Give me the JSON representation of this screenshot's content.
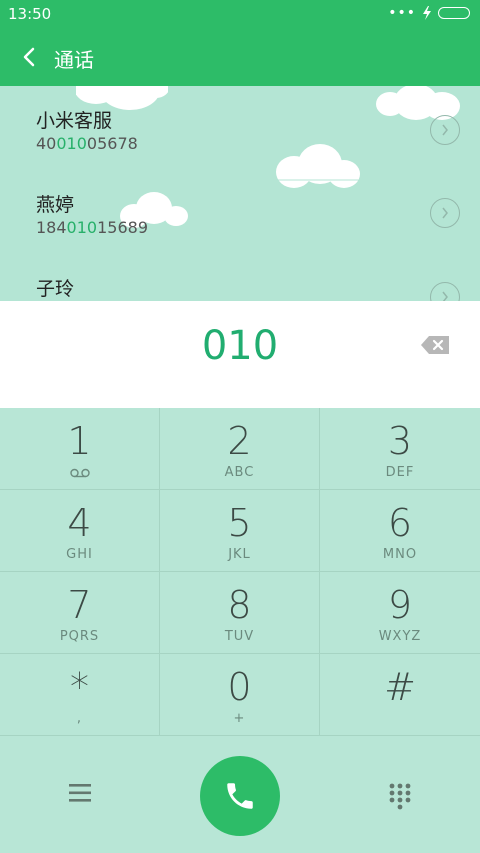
{
  "status_bar": {
    "time": "13:50"
  },
  "app_bar": {
    "title": "通话"
  },
  "results": [
    {
      "name": "小米客服",
      "number_pre": "40",
      "number_match": "010",
      "number_post": "05678"
    },
    {
      "name": "燕婷",
      "number_pre": "184",
      "number_match": "010",
      "number_post": "15689"
    },
    {
      "name": "子玲"
    }
  ],
  "input": {
    "digits": "010"
  },
  "keypad": {
    "keys": [
      {
        "digit": "1",
        "letters": ""
      },
      {
        "digit": "2",
        "letters": "ABC"
      },
      {
        "digit": "3",
        "letters": "DEF"
      },
      {
        "digit": "4",
        "letters": "GHI"
      },
      {
        "digit": "5",
        "letters": "JKL"
      },
      {
        "digit": "6",
        "letters": "MNO"
      },
      {
        "digit": "7",
        "letters": "PQRS"
      },
      {
        "digit": "8",
        "letters": "TUV"
      },
      {
        "digit": "9",
        "letters": "WXYZ"
      },
      {
        "digit": "*",
        "letters": ","
      },
      {
        "digit": "0",
        "letters": "+"
      },
      {
        "digit": "#",
        "letters": ""
      }
    ]
  },
  "colors": {
    "accent": "#2dbc68",
    "match": "#27b06a",
    "keypad_bg": "#b8e6d6"
  }
}
